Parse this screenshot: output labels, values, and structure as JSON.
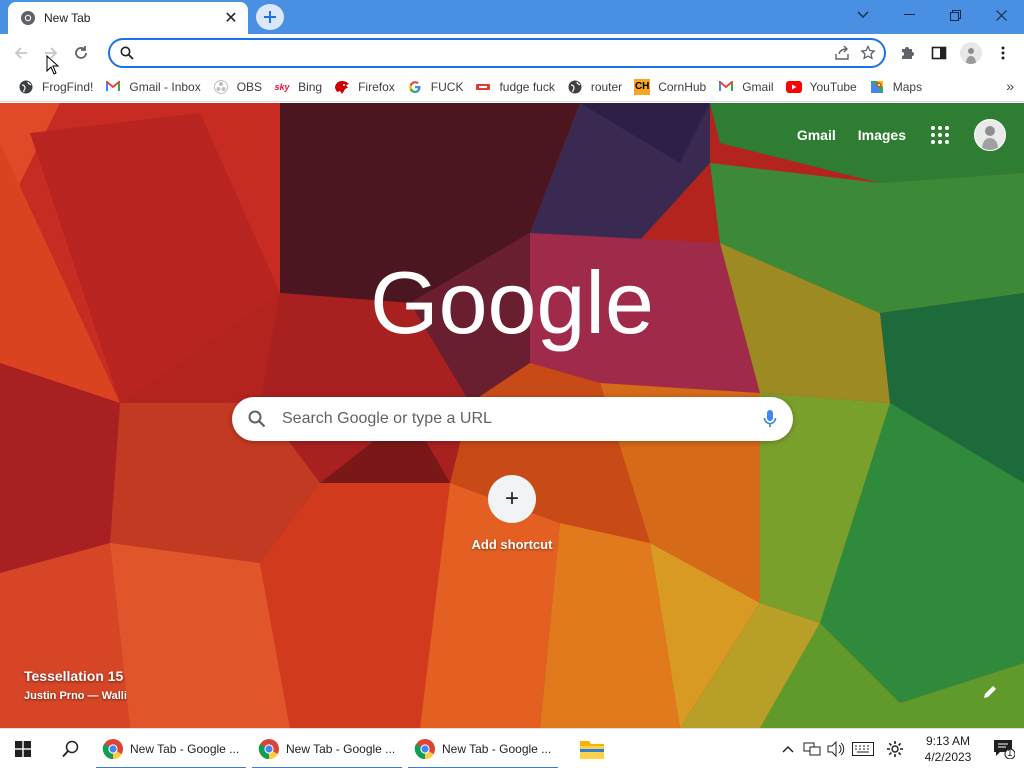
{
  "browser": {
    "tab": {
      "title": "New Tab",
      "close": "✕"
    },
    "window_controls": {
      "minimize": "—",
      "maximize": "☐",
      "close": "✕"
    },
    "omnibox": {
      "value": "",
      "placeholder": ""
    },
    "bookmarks": [
      {
        "label": "FrogFind!",
        "icon": "globe-icon"
      },
      {
        "label": "Gmail - Inbox",
        "icon": "gmail-icon"
      },
      {
        "label": "OBS",
        "icon": "obs-icon"
      },
      {
        "label": "Bing",
        "icon": "sky-icon"
      },
      {
        "label": "Firefox",
        "icon": "firefox-icon"
      },
      {
        "label": "FUCK",
        "icon": "google-icon"
      },
      {
        "label": "fudge fuck",
        "icon": "red-bar-icon"
      },
      {
        "label": "router",
        "icon": "globe-icon"
      },
      {
        "label": "CornHub",
        "icon": "ch-icon"
      },
      {
        "label": "Gmail",
        "icon": "gmail-icon"
      },
      {
        "label": "YouTube",
        "icon": "youtube-icon"
      },
      {
        "label": "Maps",
        "icon": "maps-icon"
      }
    ],
    "bookmarks_more": "»"
  },
  "ntp": {
    "header_links": {
      "gmail": "Gmail",
      "images": "Images"
    },
    "logo": "Google",
    "search": {
      "placeholder": "Search Google or type a URL"
    },
    "shortcut": {
      "label": "Add shortcut",
      "plus": "+"
    },
    "attribution": {
      "title": "Tessellation 15",
      "author": "Justin Prno — Walli"
    }
  },
  "taskbar": {
    "apps": [
      {
        "label": "New Tab - Google ..."
      },
      {
        "label": "New Tab - Google ..."
      },
      {
        "label": "New Tab - Google ..."
      }
    ],
    "clock": {
      "time": "9:13 AM",
      "date": "4/2/2023"
    },
    "notification_count": "1"
  },
  "colors": {
    "tabstrip": "#4a90e2",
    "omnibox_focus": "#1a73e8",
    "taskbar_underline": "#3a7bd5"
  }
}
